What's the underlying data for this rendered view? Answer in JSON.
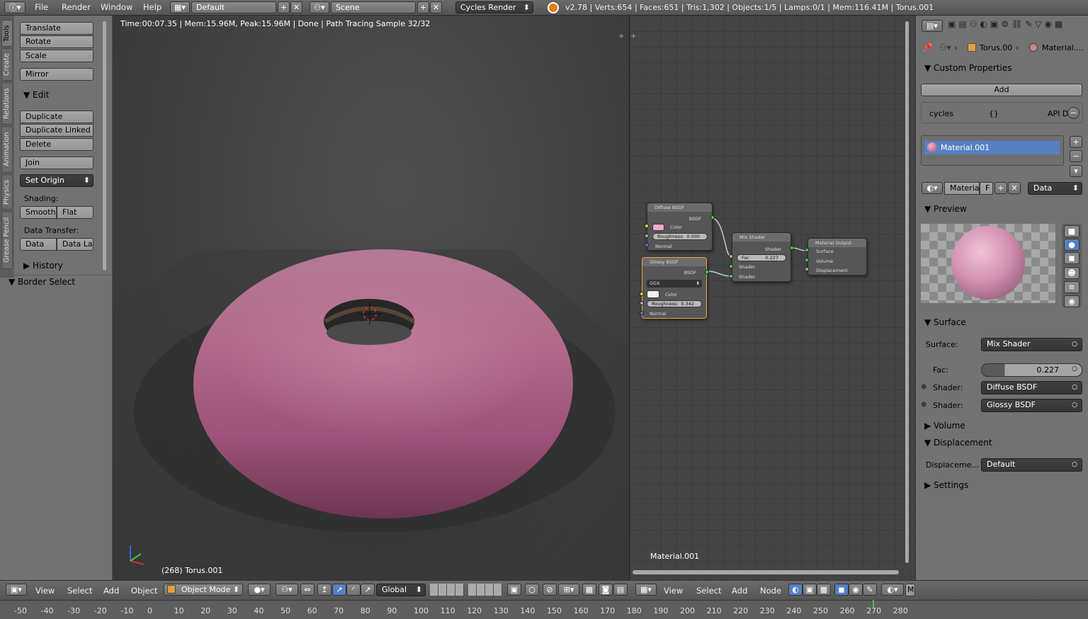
{
  "topbar": {
    "menus": [
      "File",
      "Render",
      "Window",
      "Help"
    ],
    "layout_name": "Default",
    "scene_name": "Scene",
    "engine": "Cycles Render",
    "stats": "v2.78 | Verts:654 | Faces:651 | Tris:1,302 | Objects:1/5 | Lamps:0/1 | Mem:116.41M | Torus.001"
  },
  "toolshelf": {
    "tabs": [
      "Tools",
      "Create",
      "Relations",
      "Animation",
      "Physics",
      "Grease Pencil"
    ],
    "transform_buttons": [
      "Translate",
      "Rotate",
      "Scale"
    ],
    "mirror": "Mirror",
    "edit_header": "Edit",
    "edit_buttons": [
      "Duplicate",
      "Duplicate Linked",
      "Delete"
    ],
    "join": "Join",
    "set_origin": "Set Origin",
    "shading_label": "Shading:",
    "smooth": "Smooth",
    "flat": "Flat",
    "data_transfer_label": "Data Transfer:",
    "data": "Data",
    "data_layout": "Data La",
    "history": "History",
    "border_select": "Border Select"
  },
  "viewport": {
    "render_info": "Time:00:07.35 | Mem:15.96M, Peak:15.96M | Done | Path Tracing Sample 32/32",
    "object_label": "(268) Torus.001",
    "torus_color": "#b9728f"
  },
  "node_editor": {
    "material_name": "Material.001",
    "diffuse": {
      "title": "Diffuse BSDF",
      "out": "BSDF",
      "color_label": "Color",
      "roughness_label": "Roughness:",
      "roughness": "0.000",
      "normal": "Normal",
      "color_swatch": "#f2a9cf"
    },
    "glossy": {
      "title": "Glossy BSDF",
      "out": "BSDF",
      "dist": "GGX",
      "color_label": "Color",
      "roughness_label": "Roughness:",
      "roughness": "0.342",
      "normal": "Normal"
    },
    "mix": {
      "title": "Mix Shader",
      "out": "Shader",
      "fac_label": "Fac",
      "fac": "0.227",
      "shader1": "Shader",
      "shader2": "Shader"
    },
    "output": {
      "title": "Material Output",
      "surface": "Surface",
      "volume": "Volume",
      "displacement": "Displacement"
    },
    "menus": [
      "View",
      "Select",
      "Add",
      "Node"
    ]
  },
  "properties": {
    "breadcrumb_obj": "Torus.00",
    "breadcrumb_mat": "Material....",
    "custom_props_header": "Custom Properties",
    "add": "Add",
    "cycles": "cycles",
    "cycles_val": "{}",
    "api": "API D",
    "material_slot": "Material.001",
    "material_field": "Material",
    "f_label": "F",
    "data_select": "Data",
    "preview_header": "Preview",
    "surface_header": "Surface",
    "surface_label": "Surface:",
    "surface_value": "Mix Shader",
    "fac_label": "Fac:",
    "fac_value": "0.227",
    "shader_label": "Shader:",
    "shader1_value": "Diffuse BSDF",
    "shader2_value": "Glossy BSDF",
    "volume_header": "Volume",
    "displacement_header": "Displacement",
    "displacement_label": "Displaceme...",
    "displacement_value": "Default",
    "settings_header": "Settings"
  },
  "bottombar": {
    "menus": [
      "View",
      "Select",
      "Add",
      "Object"
    ],
    "mode": "Object Mode",
    "orientation": "Global",
    "right_menus": [
      "View",
      "Select",
      "Add",
      "Node"
    ]
  },
  "timeline": {
    "ticks": [
      "-50",
      "-40",
      "-30",
      "-20",
      "-10",
      "0",
      "10",
      "20",
      "30",
      "40",
      "50",
      "60",
      "70",
      "80",
      "90",
      "100",
      "110",
      "120",
      "130",
      "140",
      "150",
      "160",
      "170",
      "180",
      "190",
      "200",
      "210",
      "220",
      "230",
      "240",
      "250",
      "260",
      "270",
      "280"
    ],
    "current_frame": 268
  }
}
